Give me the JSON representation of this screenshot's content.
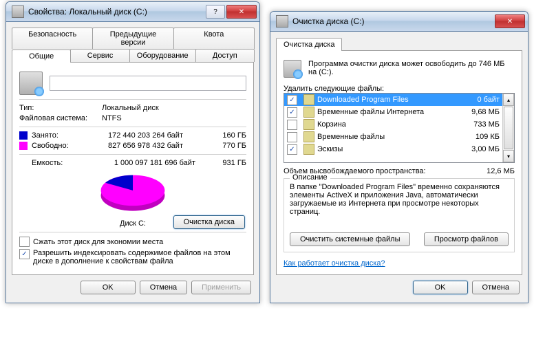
{
  "props_window": {
    "title": "Свойства: Локальный диск (C:)",
    "tabs_row1": [
      "Безопасность",
      "Предыдущие версии",
      "Квота"
    ],
    "tabs_row2": [
      "Общие",
      "Сервис",
      "Оборудование",
      "Доступ"
    ],
    "type_label": "Тип:",
    "type_value": "Локальный диск",
    "fs_label": "Файловая система:",
    "fs_value": "NTFS",
    "used_label": "Занято:",
    "used_bytes": "172 440 203 264 байт",
    "used_gb": "160 ГБ",
    "free_label": "Свободно:",
    "free_bytes": "827 656 978 432 байт",
    "free_gb": "770 ГБ",
    "capacity_label": "Емкость:",
    "capacity_bytes": "1 000 097 181 696 байт",
    "capacity_gb": "931 ГБ",
    "disk_label": "Диск C:",
    "cleanup_btn": "Очистка диска",
    "compress_label": "Сжать этот диск для экономии места",
    "index_label": "Разрешить индексировать содержимое файлов на этом диске в дополнение к свойствам файла",
    "ok": "OK",
    "cancel": "Отмена",
    "apply": "Применить",
    "used_color": "#0000cc",
    "free_color": "#ff00ff"
  },
  "cleanup_window": {
    "title": "Очистка диска  (C:)",
    "tab": "Очистка диска",
    "summary": "Программа очистки диска может освободить до 746 МБ на  (C:).",
    "delete_label": "Удалить следующие файлы:",
    "items": [
      {
        "checked": true,
        "name": "Downloaded Program Files",
        "size": "0 байт",
        "selected": true
      },
      {
        "checked": true,
        "name": "Временные файлы Интернета",
        "size": "9,68 МБ"
      },
      {
        "checked": false,
        "name": "Корзина",
        "size": "733 МБ"
      },
      {
        "checked": false,
        "name": "Временные файлы",
        "size": "109 КБ"
      },
      {
        "checked": true,
        "name": "Эскизы",
        "size": "3,00 МБ"
      }
    ],
    "freed_label": "Объем высвобождаемого пространства:",
    "freed_value": "12,6 МБ",
    "desc_title": "Описание",
    "desc_text": "В папке \"Downloaded Program Files\" временно сохраняются элементы ActiveX и приложения Java, автоматически загружаемые из Интернета при просмотре некоторых страниц.",
    "clean_sys_btn": "Очистить системные файлы",
    "view_files_btn": "Просмотр файлов",
    "how_link": "Как работает очистка диска?",
    "ok": "OK",
    "cancel": "Отмена"
  },
  "chart_data": {
    "type": "pie",
    "title": "Диск C:",
    "series": [
      {
        "name": "Занято",
        "value": 160,
        "color": "#0000cc"
      },
      {
        "name": "Свободно",
        "value": 770,
        "color": "#ff00ff"
      }
    ],
    "unit": "ГБ"
  }
}
